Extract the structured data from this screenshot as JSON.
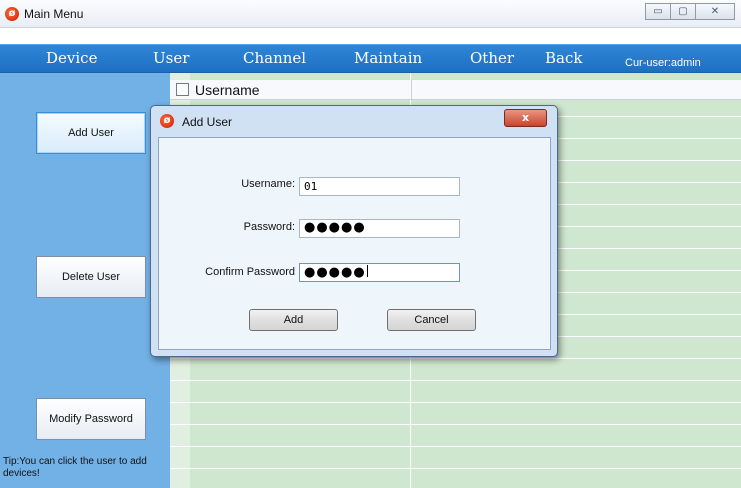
{
  "window": {
    "title": "Main Menu",
    "icon": "app-logo-icon",
    "controls": {
      "minimize": "▭",
      "maximize": "▢",
      "close": "✕"
    }
  },
  "menubar": {
    "items": [
      "Device",
      "User",
      "Channel",
      "Maintain",
      "Other",
      "Back"
    ],
    "cur_user": "Cur-user:admin"
  },
  "sidebar": {
    "buttons": [
      "Add User",
      "Delete User",
      "Modify Password"
    ],
    "tip": "Tip:You can click the user to add devices!"
  },
  "table": {
    "header": "Username"
  },
  "dialog": {
    "title": "Add User",
    "close_label": "x",
    "fields": {
      "username_label": "Username:",
      "username_value": "01",
      "password_label": "Password:",
      "password_value": "●●●●●",
      "confirm_label": "Confirm Password",
      "confirm_value": "●●●●●"
    },
    "add_label": "Add",
    "cancel_label": "Cancel"
  },
  "colors": {
    "menubar": "#2a7fd0",
    "sidebar": "#72b1e6",
    "table_row": "#cfe6cf",
    "dialog_frame": "#cfe1f2"
  }
}
